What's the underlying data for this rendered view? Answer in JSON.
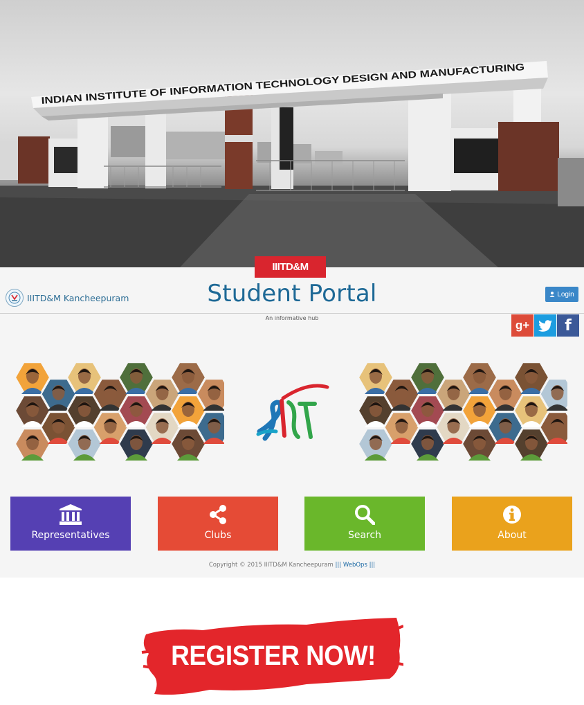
{
  "hero": {
    "gate_sign": "INDIAN INSTITUTE OF INFORMATION TECHNOLOGY DESIGN AND MANUFACTURING"
  },
  "header": {
    "tab_label": "IIITD&M",
    "brand_label": "IIITD&M Kancheepuram",
    "title": "Student Portal",
    "tagline": "An informative hub",
    "login_label": "Login",
    "login_icon": "user-icon"
  },
  "social": [
    {
      "name": "google-plus",
      "label": "g+",
      "color": "#dd4b39"
    },
    {
      "name": "twitter",
      "icon": "twitter-bird-icon",
      "color": "#1c9de0"
    },
    {
      "name": "facebook",
      "label": "f",
      "color": "#3b5998"
    }
  ],
  "tiles": [
    {
      "label": "Representatives",
      "icon": "institution-icon",
      "color": "#5540b3"
    },
    {
      "label": "Clubs",
      "icon": "share-icon",
      "color": "#e54b36"
    },
    {
      "label": "Search",
      "icon": "search-icon",
      "color": "#6ab72b"
    },
    {
      "label": "About",
      "icon": "info-icon",
      "color": "#eaa21c"
    }
  ],
  "footer": {
    "text": "Copyright © 2015 IIITD&M Kancheepuram",
    "separator_left": "|||",
    "link_label": "WebOps",
    "separator_right": "|||"
  },
  "register": {
    "label": "REGISTER NOW!",
    "color": "#e3262b"
  }
}
